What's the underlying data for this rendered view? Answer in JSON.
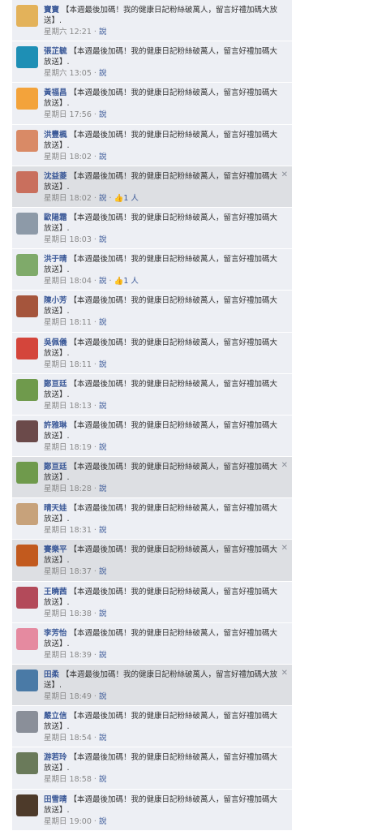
{
  "message": "【本週最後加碼！我的健康日記粉絲破萬人，留言好禮加碼大放送】.",
  "reply_label": "說",
  "close_label": "✕",
  "comments": [
    {
      "name": "寶寶",
      "time": "星期六 12:21",
      "likes": "",
      "hl": false,
      "av": "#e3b25a"
    },
    {
      "name": "張芷毓",
      "time": "星期六 13:05",
      "likes": "",
      "hl": false,
      "av": "#1e8fb5"
    },
    {
      "name": "黃福昌",
      "time": "星期日 17:56",
      "likes": "",
      "hl": false,
      "av": "#f3a33b"
    },
    {
      "name": "洪豐楓",
      "time": "星期日 18:02",
      "likes": "",
      "hl": false,
      "av": "#d98a66"
    },
    {
      "name": "沈益菱",
      "time": "星期日 18:02",
      "likes": "1 人",
      "hl": true,
      "av": "#c96f5d"
    },
    {
      "name": "歐陽霜",
      "time": "星期日 18:03",
      "likes": "",
      "hl": false,
      "av": "#8d9aa8"
    },
    {
      "name": "洪于晴",
      "time": "星期日 18:04",
      "likes": "1 人",
      "hl": false,
      "av": "#7faa6a"
    },
    {
      "name": "陳小芳",
      "time": "星期日 18:11",
      "likes": "",
      "hl": false,
      "av": "#a5553c"
    },
    {
      "name": "吳佩儀",
      "time": "星期日 18:11",
      "likes": "",
      "hl": false,
      "av": "#d4453b"
    },
    {
      "name": "鄭亘廷",
      "time": "星期日 18:13",
      "likes": "",
      "hl": false,
      "av": "#6f9a4c"
    },
    {
      "name": "許雅琳",
      "time": "星期日 18:19",
      "likes": "",
      "hl": false,
      "av": "#6b4a4a"
    },
    {
      "name": "鄭亘廷",
      "time": "星期日 18:28",
      "likes": "",
      "hl": true,
      "av": "#6f9a4c"
    },
    {
      "name": "晴天娃",
      "time": "星期日 18:31",
      "likes": "",
      "hl": false,
      "av": "#c7a27b"
    },
    {
      "name": "賽樂平",
      "time": "星期日 18:37",
      "likes": "",
      "hl": true,
      "av": "#c25a1e"
    },
    {
      "name": "王曉茜",
      "time": "星期日 18:38",
      "likes": "",
      "hl": false,
      "av": "#b34a5a"
    },
    {
      "name": "李芳怡",
      "time": "星期日 18:39",
      "likes": "",
      "hl": false,
      "av": "#e58aa0"
    },
    {
      "name": "田柔",
      "time": "星期日 18:49",
      "likes": "",
      "hl": true,
      "av": "#4a7aa6"
    },
    {
      "name": "嚴立信",
      "time": "星期日 18:54",
      "likes": "",
      "hl": false,
      "av": "#8a8f99"
    },
    {
      "name": "游若玲",
      "time": "星期日 18:58",
      "likes": "",
      "hl": false,
      "av": "#6a7a5a"
    },
    {
      "name": "田雪晴",
      "time": "星期日 19:00",
      "likes": "",
      "hl": false,
      "av": "#4d3a2a"
    }
  ]
}
